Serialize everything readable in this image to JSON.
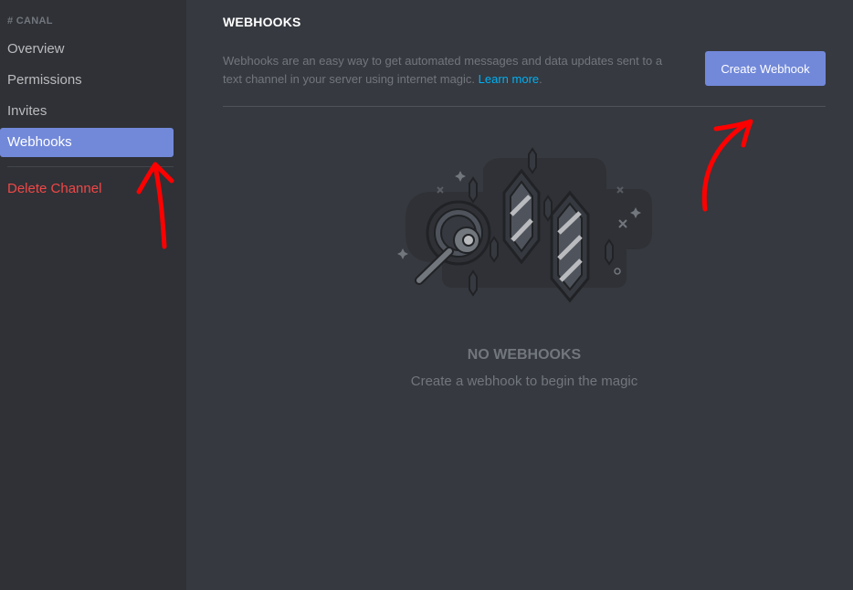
{
  "sidebar": {
    "header": "# CANAL",
    "items": [
      {
        "label": "Overview"
      },
      {
        "label": "Permissions"
      },
      {
        "label": "Invites"
      },
      {
        "label": "Webhooks"
      },
      {
        "label": "Delete Channel"
      }
    ]
  },
  "main": {
    "title": "WEBHOOKS",
    "description": "Webhooks are an easy way to get automated messages and data updates sent to a text channel in your server using internet magic.",
    "learn_more": "Learn more",
    "period": ".",
    "create_button": "Create Webhook",
    "empty_title": "NO WEBHOOKS",
    "empty_subtitle": "Create a webhook to begin the magic"
  },
  "colors": {
    "accent": "#7289da",
    "danger": "#f04747",
    "link": "#00b0f4",
    "annotation": "#ff0000"
  }
}
